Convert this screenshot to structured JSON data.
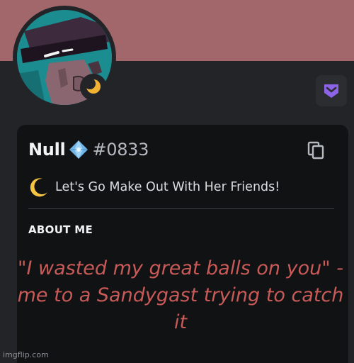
{
  "profile": {
    "username": "Null",
    "discriminator": "#0833",
    "badge_icon": "crystal-diamond-icon",
    "custom_status": {
      "emoji": "crescent-moon-icon",
      "text": "Let's Go Make Out With Her Friends!"
    },
    "presence": "idle",
    "avatar_alt_icon": "avatar-character-icon"
  },
  "sections": {
    "about_me_heading": "ABOUT ME",
    "about_me_text": "\"I wasted my great balls on you\" - me to a Sandygast trying to catch it"
  },
  "actions": {
    "copy_icon": "copy-icon",
    "nitro_icon": "nitro-badge-icon"
  },
  "watermark": "imgflip.com",
  "colors": {
    "banner": "#a2676b",
    "background": "#232428",
    "card": "#111214",
    "accent_purple": "#8d64e8",
    "about_text": "#c85a57"
  }
}
